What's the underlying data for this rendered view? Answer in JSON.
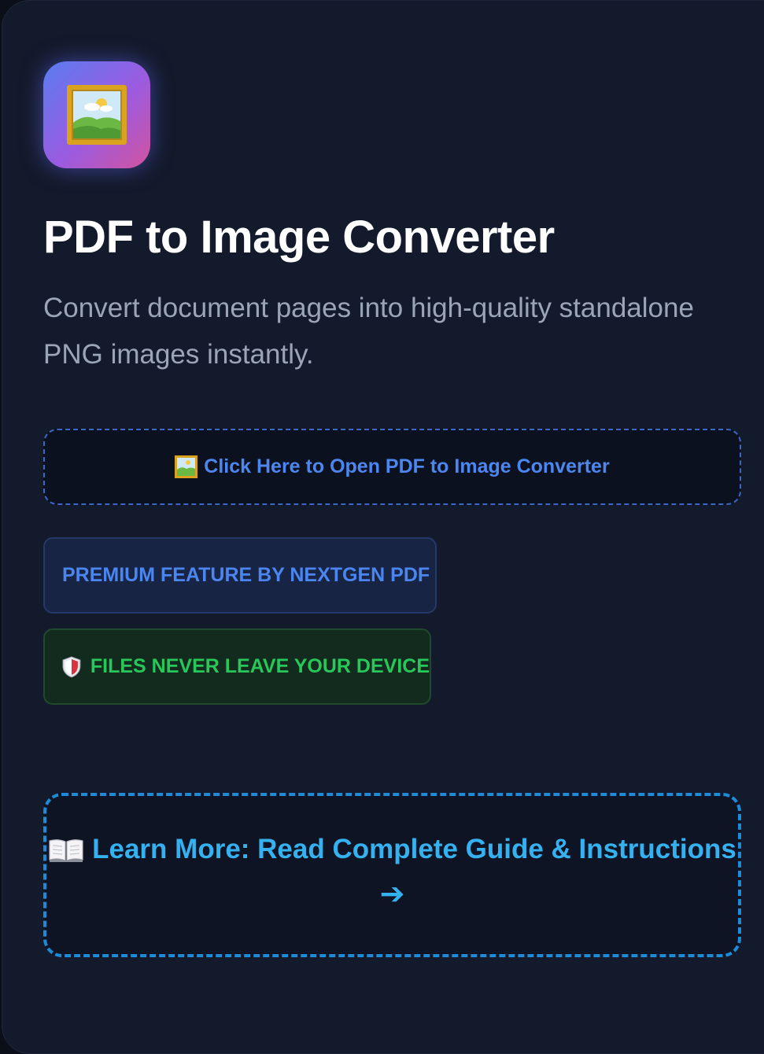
{
  "app": {
    "icon": "framed-picture-icon",
    "title": "PDF to Image Converter",
    "subtitle": "Convert document pages into high-quality standalone PNG images instantly."
  },
  "open_button": {
    "icon": "framed-picture-icon",
    "label": "Click Here to Open PDF to Image Converter"
  },
  "badges": {
    "premium": "PREMIUM FEATURE BY NEXTGEN PDF",
    "secure_icon": "shield-icon",
    "secure": "FILES NEVER LEAVE YOUR DEVICE"
  },
  "learn_more": {
    "icon": "open-book-icon",
    "label": "Learn More: Read Complete Guide & Instructions",
    "arrow": "➔"
  },
  "colors": {
    "background": "#131a2b",
    "accent_blue": "#4b86f0",
    "accent_green": "#27c75a",
    "accent_cyan": "#36b1f0",
    "icon_gradient_start": "#5a7cf0",
    "icon_gradient_end": "#d2539f"
  }
}
